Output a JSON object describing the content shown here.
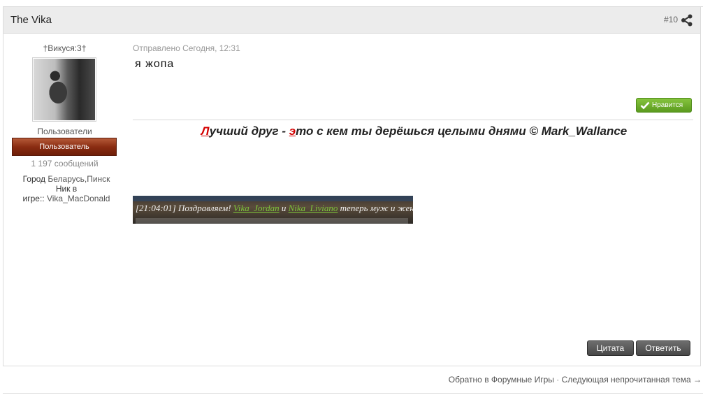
{
  "post": {
    "author": "The Vika",
    "number": "#10",
    "date": "Отправлено Сегодня, 12:31",
    "body": "я  жопа",
    "like_label": "Нравится",
    "quote_label": "Цитата",
    "reply_label": "Ответить"
  },
  "author_info": {
    "title": "†Викуся:3†",
    "group": "Пользователи",
    "badge": "Пользователь",
    "post_count": "1  197 сообщений",
    "city_label": "Город",
    "city_value": "Беларусь,Пинск",
    "nick_label_line1": "Ник в",
    "nick_label_line2": "игре::",
    "nick_value": "Vika_MacDonald"
  },
  "signature": {
    "q_first_red": "Л",
    "q_part1": "учший друг - ",
    "q_second_red": "э",
    "q_part2": "то с кем ты дерёшься целыми днями © Mark_Wallance",
    "img_time": "[21:04:01] Поздравляем! ",
    "img_name1": "Vika_Jordan",
    "img_and": " и ",
    "img_name2": "Nika_Liviano",
    "img_rest": " теперь муж и жена!"
  },
  "nav": {
    "back": "Обратно в Форумные Игры",
    "separator": " · ",
    "next": "Следующая непрочитанная тема",
    "arrow": " →"
  },
  "colors": {
    "like_green": "#6fb02c",
    "badge_red": "#8a2c12",
    "signature_red": "#d40000"
  },
  "icons": [
    "share-icon",
    "check-icon"
  ]
}
